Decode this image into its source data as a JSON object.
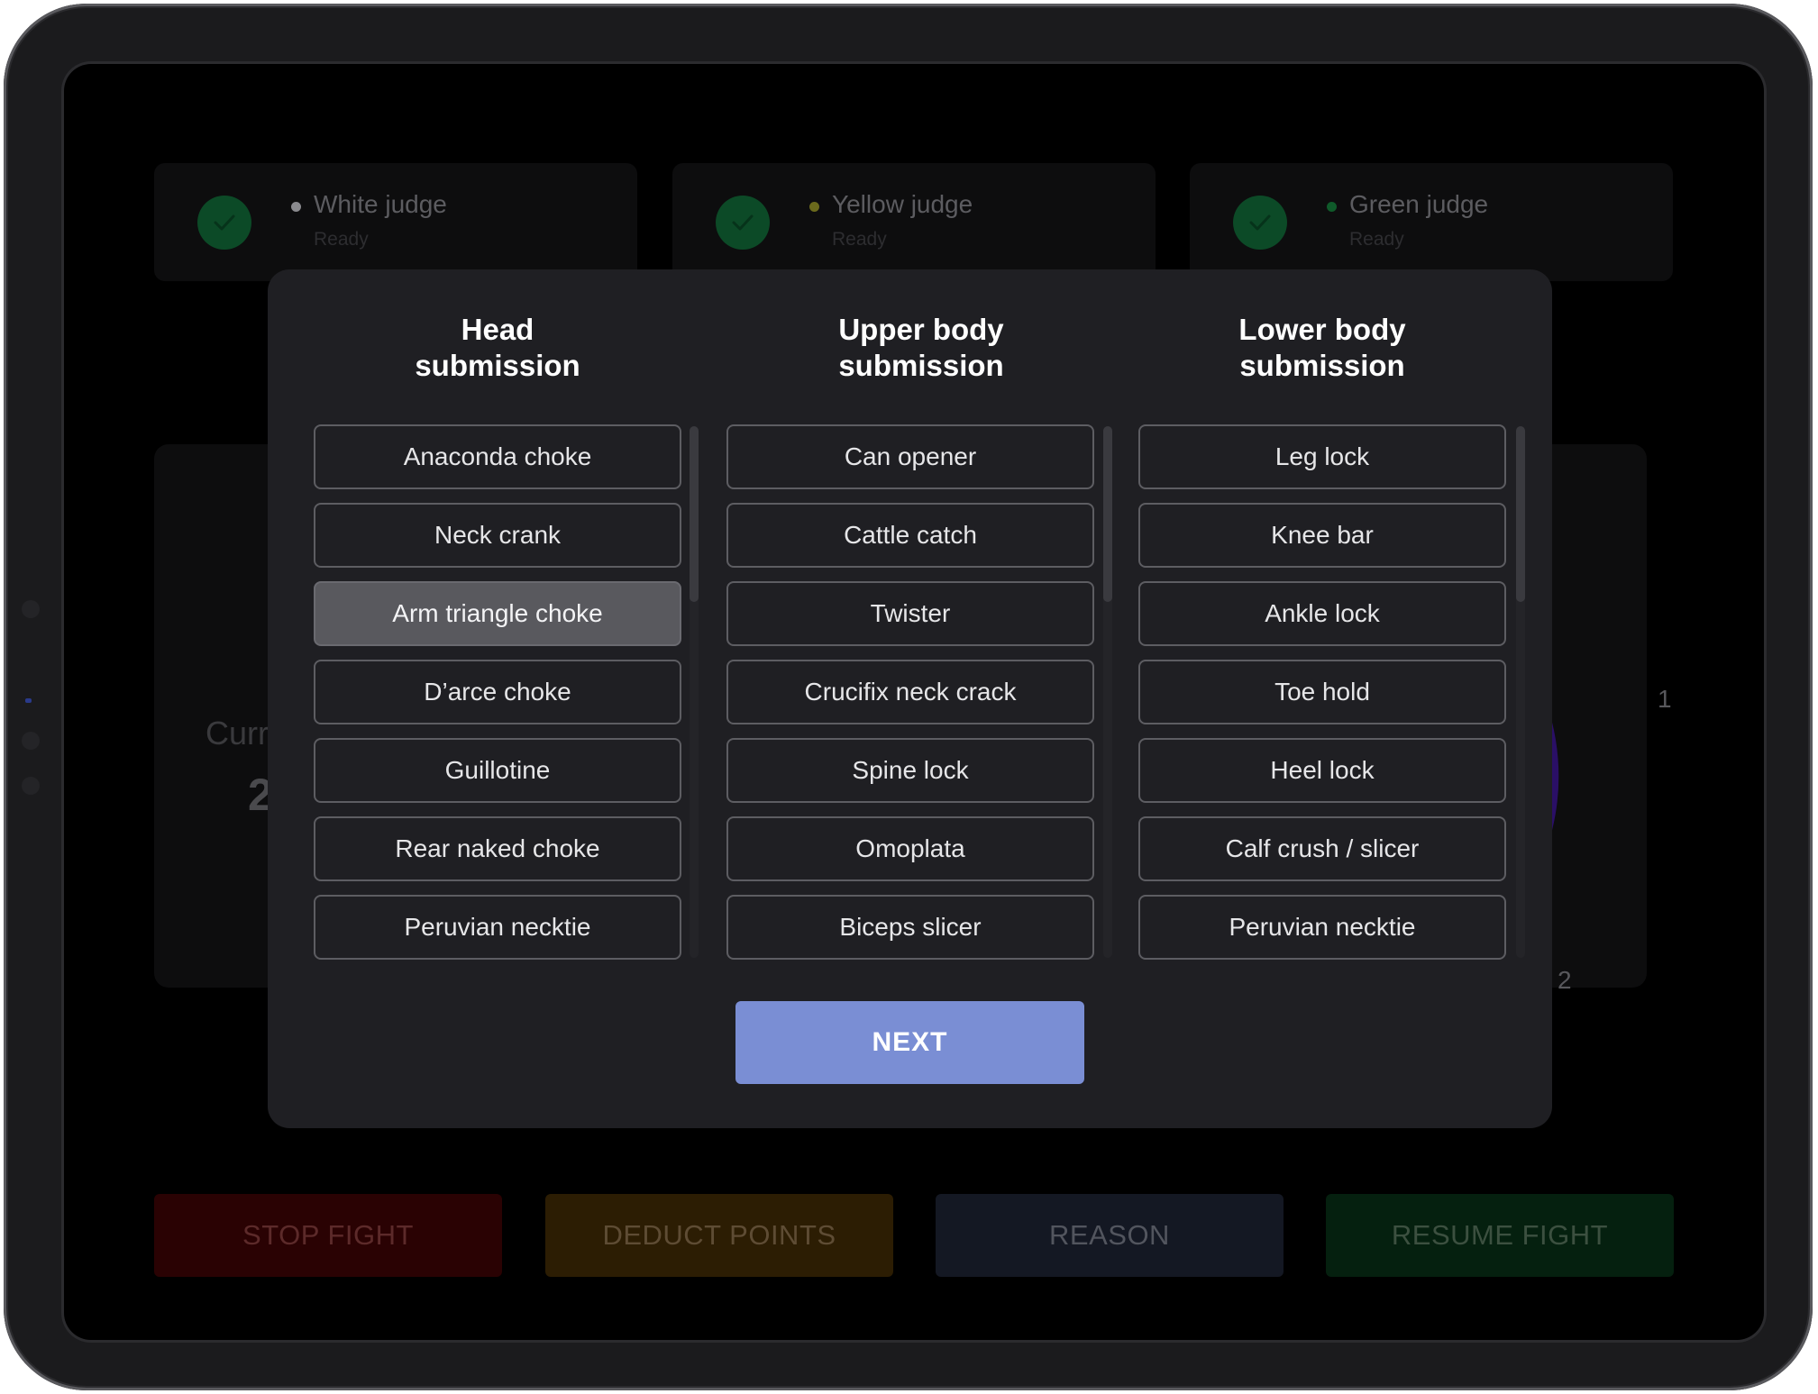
{
  "judges": [
    {
      "name": "White judge",
      "status": "Ready",
      "dot_color": "#8a8a8e"
    },
    {
      "name": "Yellow judge",
      "status": "Ready",
      "dot_color": "#6b6a1c"
    },
    {
      "name": "Green judge",
      "status": "Ready",
      "dot_color": "#0f5a2a"
    }
  ],
  "score": {
    "label": "Curr",
    "value": "2",
    "dial_labels": [
      "1",
      "2"
    ]
  },
  "modal": {
    "columns": [
      {
        "title_line1": "Head",
        "title_line2": "submission",
        "options": [
          "Anaconda choke",
          "Neck crank",
          "Arm triangle choke",
          "D’arce choke",
          "Guillotine",
          "Rear naked choke",
          "Peruvian necktie"
        ],
        "selected": "Arm triangle choke"
      },
      {
        "title_line1": "Upper body",
        "title_line2": "submission",
        "options": [
          "Can opener",
          "Cattle catch",
          "Twister",
          "Crucifix neck crack",
          "Spine lock",
          "Omoplata",
          "Biceps slicer"
        ],
        "selected": null
      },
      {
        "title_line1": "Lower body",
        "title_line2": "submission",
        "options": [
          "Leg lock",
          "Knee bar",
          "Ankle lock",
          "Toe hold",
          "Heel lock",
          "Calf crush / slicer",
          "Peruvian necktie"
        ],
        "selected": null
      }
    ],
    "next_label": "NEXT"
  },
  "actions": [
    {
      "label": "STOP FIGHT",
      "bg": "#2a0203",
      "fg": "#5c2a2a"
    },
    {
      "label": "DEDUCT POINTS",
      "bg": "#2c1d03",
      "fg": "#5e4c34"
    },
    {
      "label": "REASON",
      "bg": "#141823",
      "fg": "#52555e"
    },
    {
      "label": "RESUME FIGHT",
      "bg": "#05200f",
      "fg": "#3c5040"
    }
  ],
  "colors": {
    "accent": "#7a8ed4",
    "modal_bg": "#1f1f23",
    "selected_option": "#59595e",
    "dial_arc": "#2a0f66"
  }
}
